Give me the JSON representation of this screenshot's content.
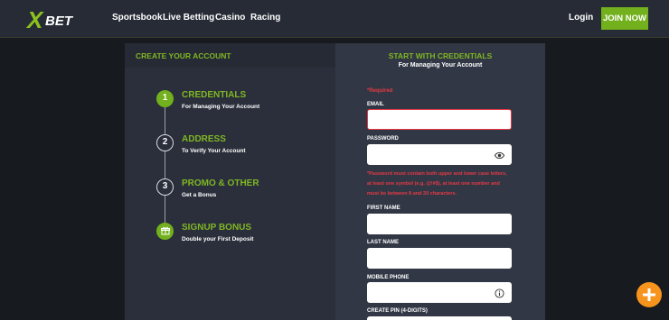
{
  "header": {
    "logo_text": "XBET",
    "nav": [
      "Sportsbook",
      "Live Betting",
      "Casino",
      "Racing"
    ],
    "login": "Login",
    "join": "JOIN NOW"
  },
  "left": {
    "heading": "CREATE YOUR ACCOUNT",
    "steps": [
      {
        "num": "1",
        "title": "CREDENTIALS",
        "subtitle": "For Managing Your Account"
      },
      {
        "num": "2",
        "title": "ADDRESS",
        "subtitle": "To Verify Your Account"
      },
      {
        "num": "3",
        "title": "PROMO & OTHER",
        "subtitle": "Get a Bonus"
      },
      {
        "num": "",
        "title": "SIGNUP BONUS",
        "subtitle": "Double your First Deposit"
      }
    ]
  },
  "form": {
    "title": "START WITH CREDENTIALS",
    "subtitle": "For Managing Your Account",
    "required": "*Required",
    "email_label": "EMAIL",
    "password_label": "PASSWORD",
    "password_note_1": "*Password must contain both upper and lower case letters,",
    "password_note_2": "at least one symbol (e.g. @!#$), at least one number and",
    "password_note_3": "must be between 8 and 20 characters.",
    "first_name_label": "FIRST NAME",
    "last_name_label": "LAST NAME",
    "mobile_label": "MOBILE PHONE",
    "pin_label": "CREATE PIN (4-DIGITS)",
    "email_value": "",
    "password_value": "",
    "first_name_value": "",
    "last_name_value": "",
    "mobile_value": ""
  },
  "colors": {
    "accent": "#72b01d",
    "error": "#e63945",
    "fab": "#f7941d"
  }
}
